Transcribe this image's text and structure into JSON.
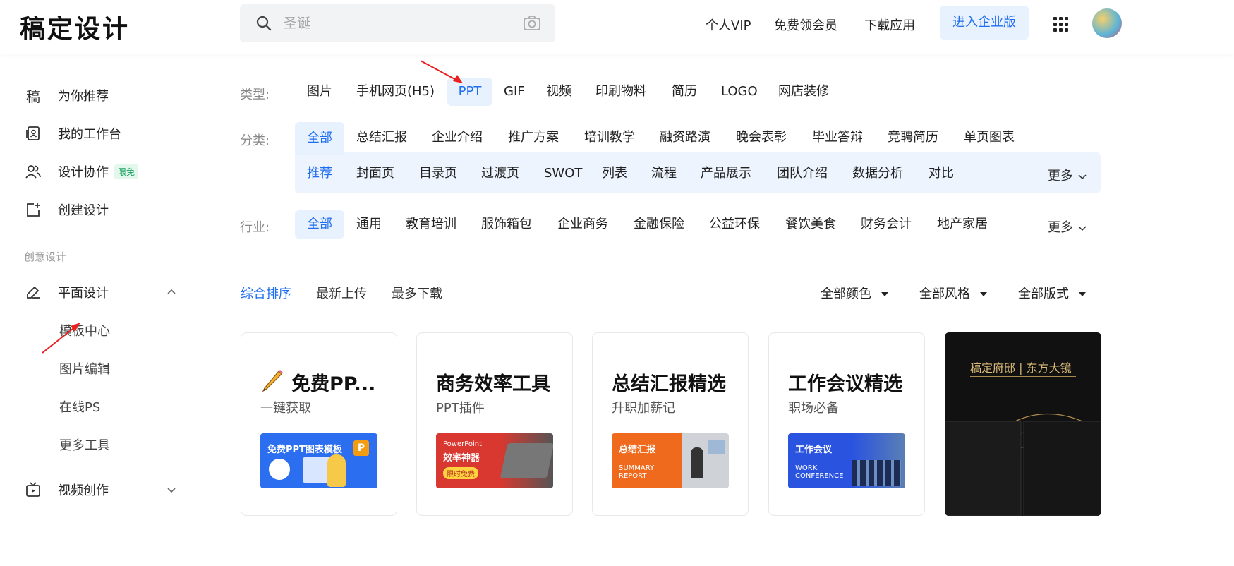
{
  "header": {
    "logo": "稿定设计",
    "search_placeholder": "圣诞",
    "links": [
      "个人VIP",
      "免费领会员",
      "下载应用"
    ],
    "enterprise_button": "进入企业版"
  },
  "sidebar": {
    "items": [
      {
        "label": "为你推荐",
        "icon": "gao-logo-icon"
      },
      {
        "label": "我的工作台",
        "icon": "workspace-icon"
      },
      {
        "label": "设计协作",
        "icon": "users-icon",
        "badge": "限免"
      },
      {
        "label": "创建设计",
        "icon": "add-design-icon"
      }
    ],
    "section_label": "创意设计",
    "graphic_design": {
      "label": "平面设计",
      "icon": "pen-icon"
    },
    "sub_items": [
      "模板中心",
      "图片编辑",
      "在线PS",
      "更多工具"
    ],
    "video": {
      "label": "视频创作",
      "icon": "video-icon"
    }
  },
  "filters": {
    "type_label": "类型:",
    "types": [
      "图片",
      "手机网页(H5)",
      "PPT",
      "GIF",
      "视频",
      "印刷物料",
      "简历",
      "LOGO",
      "网店装修"
    ],
    "category_label": "分类:",
    "categories": [
      "全部",
      "总结汇报",
      "企业介绍",
      "推广方案",
      "培训教学",
      "融资路演",
      "晚会表彰",
      "毕业答辩",
      "竞聘简历",
      "单页图表"
    ],
    "subcategories": [
      "推荐",
      "封面页",
      "目录页",
      "过渡页",
      "SWOT",
      "列表",
      "流程",
      "产品展示",
      "团队介绍",
      "数据分析",
      "对比"
    ],
    "more": "更多",
    "industry_label": "行业:",
    "industries": [
      "全部",
      "通用",
      "教育培训",
      "服饰箱包",
      "企业商务",
      "金融保险",
      "公益环保",
      "餐饮美食",
      "财务会计",
      "地产家居"
    ]
  },
  "sort": {
    "options": [
      "综合排序",
      "最新上传",
      "最多下载"
    ],
    "dropdowns": [
      "全部颜色",
      "全部风格",
      "全部版式"
    ]
  },
  "cards": [
    {
      "title": "免费PP...",
      "subtitle": "一键获取",
      "banner": "免费PPT图表模板",
      "banner_color": "#2b6ff0"
    },
    {
      "title": "商务效率工具",
      "subtitle": "PPT插件",
      "banner": "PowerPoint",
      "banner_line2": "效率神器",
      "banner_tag": "限时免费",
      "banner_color": "#d8382f"
    },
    {
      "title": "总结汇报精选",
      "subtitle": "升职加薪记",
      "banner": "总结汇报",
      "banner_sub1": "SUMMARY",
      "banner_sub2": "REPORT",
      "banner_color": "#f06a1d"
    },
    {
      "title": "工作会议精选",
      "subtitle": "职场必备",
      "banner": "工作会议",
      "banner_sub1": "WORK",
      "banner_sub2": "CONFERENCE",
      "banner_color": "#2a54e0"
    }
  ],
  "promo": {
    "title": "稿定府邸 | 东方大镜"
  }
}
